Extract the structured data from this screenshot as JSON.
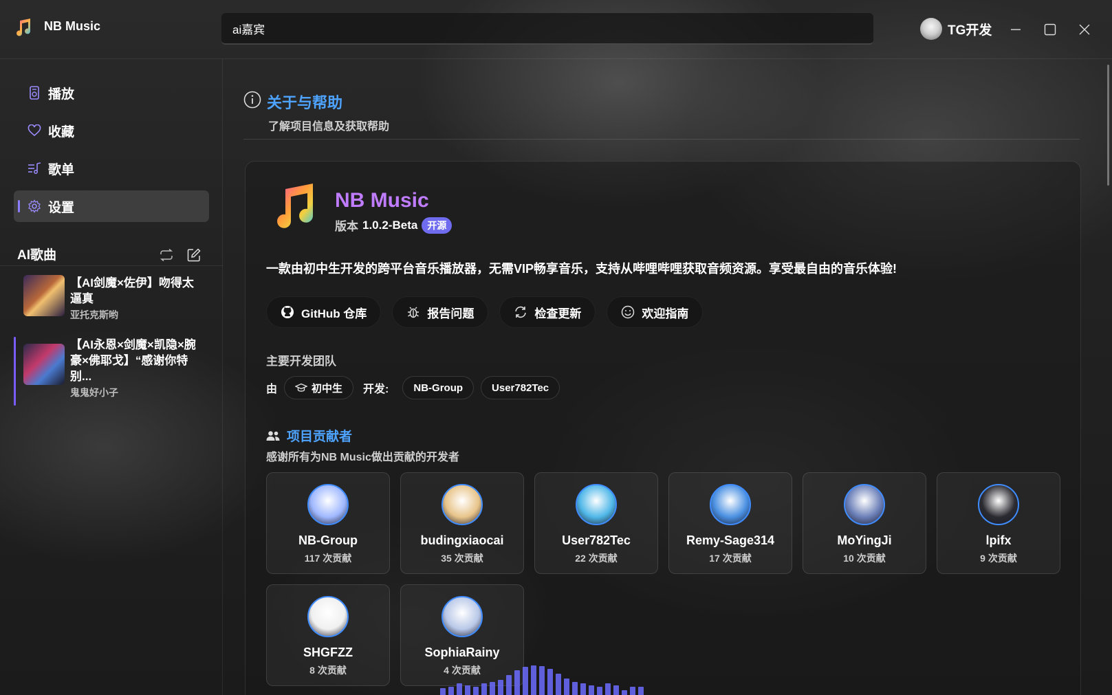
{
  "app": {
    "name": "NB Music"
  },
  "search": {
    "value": "ai嘉宾"
  },
  "user": {
    "name": "TG开发"
  },
  "sidebar": {
    "items": [
      {
        "label": "播放",
        "icon": "player-icon"
      },
      {
        "label": "收藏",
        "icon": "heart-icon"
      },
      {
        "label": "歌单",
        "icon": "playlist-icon"
      },
      {
        "label": "设置",
        "icon": "gear-icon",
        "active": true
      }
    ],
    "ai_section": {
      "title": "AI歌曲",
      "songs": [
        {
          "title": "【AI剑魔×佐伊】吻得太逼真",
          "artist": "亚托克斯哟"
        },
        {
          "title": "【AI永恩×剑魔×凯隐×腕豪×佛耶戈】“感谢你特别...",
          "artist": "鬼鬼好小子",
          "current": true
        }
      ]
    }
  },
  "page": {
    "title": "关于与帮助",
    "subtitle": "了解项目信息及获取帮助"
  },
  "about": {
    "app_name": "NB Music",
    "version_label": "版本",
    "version": "1.0.2-Beta",
    "badge": "开源",
    "description": "一款由初中生开发的跨平台音乐播放器，无需VIP畅享音乐，支持从哔哩哔哩获取音频资源。享受最自由的音乐体验!",
    "buttons": [
      {
        "label": "GitHub 仓库",
        "icon": "github-icon"
      },
      {
        "label": "报告问题",
        "icon": "bug-icon"
      },
      {
        "label": "检查更新",
        "icon": "refresh-icon"
      },
      {
        "label": "欢迎指南",
        "icon": "smile-icon"
      }
    ],
    "team": {
      "label": "主要开发团队",
      "by": "由",
      "student": "初中生",
      "dev_label": "开发:",
      "devs": [
        "NB-Group",
        "User782Tec"
      ]
    }
  },
  "contributors": {
    "title": "项目贡献者",
    "subtitle": "感谢所有为NB Music做出贡献的开发者",
    "list": [
      {
        "name": "NB-Group",
        "count": "117 次贡献",
        "color": "#9fb8ff"
      },
      {
        "name": "budingxiaocai",
        "count": "35 次贡献",
        "color": "#e8c48a"
      },
      {
        "name": "User782Tec",
        "count": "22 次贡献",
        "color": "#4fb7e8"
      },
      {
        "name": "Remy-Sage314",
        "count": "17 次贡献",
        "color": "#4a90e2"
      },
      {
        "name": "MoYingJi",
        "count": "10 次贡献",
        "color": "#6b7fb8"
      },
      {
        "name": "lpifx",
        "count": "9 次贡献",
        "color": "#2a2a30"
      },
      {
        "name": "SHGFZZ",
        "count": "8 次贡献",
        "color": "#f0f0f0"
      },
      {
        "name": "SophiaRainy",
        "count": "4 次贡献",
        "color": "#b9c8e8"
      }
    ]
  },
  "visualizer": {
    "levels": [
      0.2,
      0.25,
      0.35,
      0.3,
      0.25,
      0.35,
      0.4,
      0.45,
      0.6,
      0.75,
      0.85,
      0.9,
      0.88,
      0.8,
      0.65,
      0.5,
      0.4,
      0.35,
      0.3,
      0.25,
      0.35,
      0.3,
      0.15,
      0.25,
      0.25
    ]
  }
}
